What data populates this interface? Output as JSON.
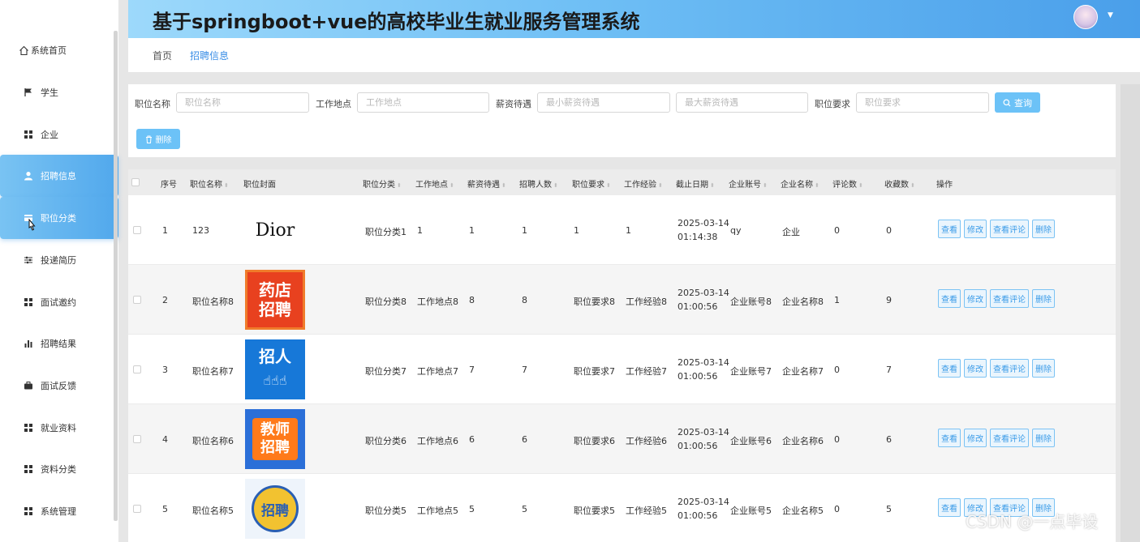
{
  "app": {
    "title": "基于springboot+vue的高校毕业生就业服务管理系统"
  },
  "sidebar": {
    "items": [
      {
        "label": "系统首页",
        "icon": "home-icon"
      },
      {
        "label": "学生",
        "icon": "flag-icon"
      },
      {
        "label": "企业",
        "icon": "grid-icon"
      },
      {
        "label": "招聘信息",
        "icon": "user-icon",
        "active": true
      },
      {
        "label": "职位分类",
        "icon": "card-icon",
        "active": true
      },
      {
        "label": "投递简历",
        "icon": "sliders-icon"
      },
      {
        "label": "面试邀约",
        "icon": "grid-icon"
      },
      {
        "label": "招聘结果",
        "icon": "bar-chart-icon"
      },
      {
        "label": "面试反馈",
        "icon": "briefcase-icon"
      },
      {
        "label": "就业资料",
        "icon": "grid-icon"
      },
      {
        "label": "资料分类",
        "icon": "grid-icon"
      },
      {
        "label": "系统管理",
        "icon": "grid-icon"
      }
    ]
  },
  "breadcrumb": {
    "home": "首页",
    "current": "招聘信息"
  },
  "search": {
    "position_label": "职位名称",
    "position_placeholder": "职位名称",
    "location_label": "工作地点",
    "location_placeholder": "工作地点",
    "salary_label": "薪资待遇",
    "salary_min_placeholder": "最小薪资待遇",
    "salary_max_placeholder": "最大薪资待遇",
    "req_label": "职位要求",
    "req_placeholder": "职位要求",
    "query_label": "查询",
    "delete_label": "删除"
  },
  "table": {
    "headers": [
      "序号",
      "职位名称",
      "职位封面",
      "职位分类",
      "工作地点",
      "薪资待遇",
      "招聘人数",
      "职位要求",
      "工作经验",
      "截止日期",
      "企业账号",
      "企业名称",
      "评论数",
      "收藏数",
      "操作"
    ],
    "actions": [
      "查看",
      "修改",
      "查看评论",
      "删除"
    ],
    "rows": [
      {
        "idx": "1",
        "name": "123",
        "cover": "Dior",
        "category": "职位分类1",
        "location": "1",
        "salary": "1",
        "count": "1",
        "req": "1",
        "exp": "1",
        "date": "2025-03-14",
        "time": "01:14:38",
        "account": "qy",
        "company": "企业",
        "comments": "0",
        "favs": "0"
      },
      {
        "idx": "2",
        "name": "职位名称8",
        "cover": "药店招聘",
        "category": "职位分类8",
        "location": "工作地点8",
        "salary": "8",
        "count": "8",
        "req": "职位要求8",
        "exp": "工作经验8",
        "date": "2025-03-14",
        "time": "01:00:56",
        "account": "企业账号8",
        "company": "企业名称8",
        "comments": "1",
        "favs": "9"
      },
      {
        "idx": "3",
        "name": "职位名称7",
        "cover": "招人",
        "category": "职位分类7",
        "location": "工作地点7",
        "salary": "7",
        "count": "7",
        "req": "职位要求7",
        "exp": "工作经验7",
        "date": "2025-03-14",
        "time": "01:00:56",
        "account": "企业账号7",
        "company": "企业名称7",
        "comments": "0",
        "favs": "7"
      },
      {
        "idx": "4",
        "name": "职位名称6",
        "cover": "教师招聘",
        "category": "职位分类6",
        "location": "工作地点6",
        "salary": "6",
        "count": "6",
        "req": "职位要求6",
        "exp": "工作经验6",
        "date": "2025-03-14",
        "time": "01:00:56",
        "account": "企业账号6",
        "company": "企业名称6",
        "comments": "0",
        "favs": "6"
      },
      {
        "idx": "5",
        "name": "职位名称5",
        "cover": "招聘",
        "category": "职位分类5",
        "location": "工作地点5",
        "salary": "5",
        "count": "5",
        "req": "职位要求5",
        "exp": "工作经验5",
        "date": "2025-03-14",
        "time": "01:00:56",
        "account": "企业账号5",
        "company": "企业名称5",
        "comments": "0",
        "favs": "5"
      }
    ]
  },
  "watermark": "CSDN @一点毕设",
  "colors": {
    "accent": "#6cc2f7",
    "header_start": "#9dd9fb",
    "header_end": "#4a9fea",
    "link": "#3a8ee6"
  }
}
